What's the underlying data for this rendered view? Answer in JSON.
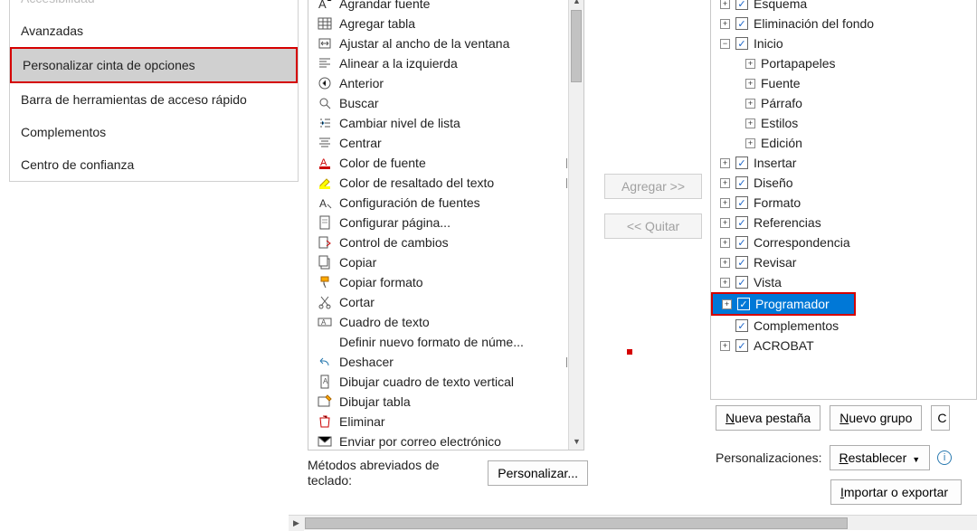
{
  "nav": {
    "items": [
      "Accesibilidad",
      "Avanzadas",
      "Personalizar cinta de opciones",
      "Barra de herramientas de acceso rápido",
      "Complementos",
      "Centro de confianza"
    ],
    "selected_index": 2
  },
  "commands": [
    {
      "label": "Agrandar fuente",
      "icon": "font-grow",
      "arrow": ""
    },
    {
      "label": "Agregar tabla",
      "icon": "table",
      "arrow": "▶"
    },
    {
      "label": "Ajustar al ancho de la ventana",
      "icon": "fit-width",
      "arrow": ""
    },
    {
      "label": "Alinear a la izquierda",
      "icon": "align-left",
      "arrow": ""
    },
    {
      "label": "Anterior",
      "icon": "back-arrow",
      "arrow": ""
    },
    {
      "label": "Buscar",
      "icon": "search",
      "arrow": ""
    },
    {
      "label": "Cambiar nivel de lista",
      "icon": "list-level",
      "arrow": "▶"
    },
    {
      "label": "Centrar",
      "icon": "align-center",
      "arrow": ""
    },
    {
      "label": "Color de fuente",
      "icon": "font-color",
      "arrow": "|▶"
    },
    {
      "label": "Color de resaltado del texto",
      "icon": "highlight",
      "arrow": "|▶"
    },
    {
      "label": "Configuración de fuentes",
      "icon": "font-settings",
      "arrow": ""
    },
    {
      "label": "Configurar página...",
      "icon": "page-setup",
      "arrow": ""
    },
    {
      "label": "Control de cambios",
      "icon": "track-changes",
      "arrow": ""
    },
    {
      "label": "Copiar",
      "icon": "copy",
      "arrow": ""
    },
    {
      "label": "Copiar formato",
      "icon": "format-painter",
      "arrow": ""
    },
    {
      "label": "Cortar",
      "icon": "cut",
      "arrow": ""
    },
    {
      "label": "Cuadro de texto",
      "icon": "textbox",
      "arrow": "▶"
    },
    {
      "label": "Definir nuevo formato de núme...",
      "icon": "blank",
      "arrow": ""
    },
    {
      "label": "Deshacer",
      "icon": "undo",
      "arrow": "|▶"
    },
    {
      "label": "Dibujar cuadro de texto vertical",
      "icon": "textbox-v",
      "arrow": ""
    },
    {
      "label": "Dibujar tabla",
      "icon": "draw-table",
      "arrow": ""
    },
    {
      "label": "Eliminar",
      "icon": "delete",
      "arrow": ""
    },
    {
      "label": "Enviar por correo electrónico",
      "icon": "email",
      "arrow": ""
    }
  ],
  "kb_shortcuts": {
    "label": "Métodos abreviados de teclado:",
    "button": "Personalizar..."
  },
  "transfer": {
    "add": "Agregar >>",
    "remove": "<< Quitar"
  },
  "tree": {
    "top": [
      {
        "label": "Esquema",
        "exp": "+",
        "chk": true,
        "indent": 0
      },
      {
        "label": "Eliminación del fondo",
        "exp": "+",
        "chk": true,
        "indent": 0
      },
      {
        "label": "Inicio",
        "exp": "-",
        "chk": true,
        "indent": 0
      }
    ],
    "inicio_children": [
      {
        "label": "Portapapeles",
        "exp": "+",
        "indent": 1
      },
      {
        "label": "Fuente",
        "exp": "+",
        "indent": 1
      },
      {
        "label": "Párrafo",
        "exp": "+",
        "indent": 1
      },
      {
        "label": "Estilos",
        "exp": "+",
        "indent": 1
      },
      {
        "label": "Edición",
        "exp": "+",
        "indent": 1
      }
    ],
    "main_tabs": [
      {
        "label": "Insertar",
        "exp": "+",
        "chk": true,
        "indent": 0
      },
      {
        "label": "Diseño",
        "exp": "+",
        "chk": true,
        "indent": 0
      },
      {
        "label": "Formato",
        "exp": "+",
        "chk": true,
        "indent": 0
      },
      {
        "label": "Referencias",
        "exp": "+",
        "chk": true,
        "indent": 0
      },
      {
        "label": "Correspondencia",
        "exp": "+",
        "chk": true,
        "indent": 0
      },
      {
        "label": "Revisar",
        "exp": "+",
        "chk": true,
        "indent": 0
      },
      {
        "label": "Vista",
        "exp": "+",
        "chk": true,
        "indent": 0
      },
      {
        "label": "Programador",
        "exp": "+",
        "chk": true,
        "indent": 0,
        "selected": true,
        "highlight": true
      },
      {
        "label": "Complementos",
        "exp": "",
        "chk": true,
        "indent": 0
      },
      {
        "label": "ACROBAT",
        "exp": "+",
        "chk": true,
        "indent": 0
      }
    ]
  },
  "buttons": {
    "new_tab": "Nueva pestaña",
    "new_group": "Nuevo grupo",
    "change": "C",
    "personalizations_label": "Personalizaciones:",
    "reset": "Restablecer",
    "import": "Importar o exportar"
  }
}
